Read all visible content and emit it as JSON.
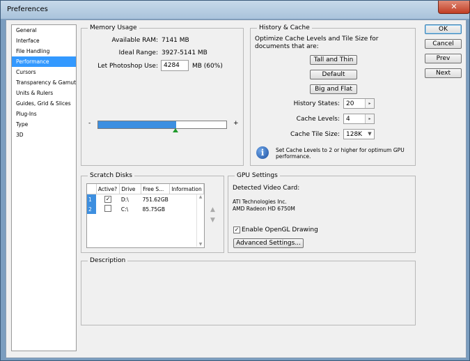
{
  "window": {
    "title": "Preferences",
    "close_glyph": "✕"
  },
  "nav": {
    "items": [
      {
        "label": "General"
      },
      {
        "label": "Interface"
      },
      {
        "label": "File Handling"
      },
      {
        "label": "Performance",
        "active": true
      },
      {
        "label": "Cursors"
      },
      {
        "label": "Transparency & Gamut"
      },
      {
        "label": "Units & Rulers"
      },
      {
        "label": "Guides, Grid & Slices"
      },
      {
        "label": "Plug-Ins"
      },
      {
        "label": "Type"
      },
      {
        "label": "3D"
      }
    ]
  },
  "memory": {
    "title": "Memory Usage",
    "available_label": "Available RAM:",
    "available_value": "7141 MB",
    "ideal_label": "Ideal Range:",
    "ideal_value": "3927-5141 MB",
    "use_label": "Let Photoshop Use:",
    "use_value": "4284",
    "use_unit": "MB (60%)",
    "slider_min_glyph": "-",
    "slider_max_glyph": "+",
    "slider_level_percent": 60
  },
  "history": {
    "title": "History & Cache",
    "desc": "Optimize Cache Levels and Tile Size for documents that are:",
    "btn_tall_thin": "Tall and Thin",
    "btn_default": "Default",
    "btn_big_flat": "Big and Flat",
    "states_label": "History States:",
    "states_value": "20",
    "levels_label": "Cache Levels:",
    "levels_value": "4",
    "tile_label": "Cache Tile Size:",
    "tile_value": "128K",
    "info": "Set Cache Levels to 2 or higher for optimum GPU performance."
  },
  "scratch": {
    "title": "Scratch Disks",
    "headers": {
      "active": "Active?",
      "drive": "Drive",
      "free": "Free S...",
      "info": "Information"
    },
    "rows": [
      {
        "num": "1",
        "checked": true,
        "check_glyph": "✓",
        "drive": "D:\\",
        "free": "751.62GB",
        "info": ""
      },
      {
        "num": "2",
        "checked": false,
        "check_glyph": "",
        "drive": "C:\\",
        "free": "85.75GB",
        "info": ""
      }
    ]
  },
  "gpu": {
    "title": "GPU Settings",
    "detected_label": "Detected Video Card:",
    "card_line1": "ATI Technologies Inc.",
    "card_line2": "AMD Radeon HD 6750M",
    "opengl_label": "Enable OpenGL Drawing",
    "opengl_check": "✓",
    "advanced_btn": "Advanced Settings..."
  },
  "description": {
    "title": "Description"
  },
  "buttons": {
    "ok": "OK",
    "cancel": "Cancel",
    "prev": "Prev",
    "next": "Next"
  }
}
